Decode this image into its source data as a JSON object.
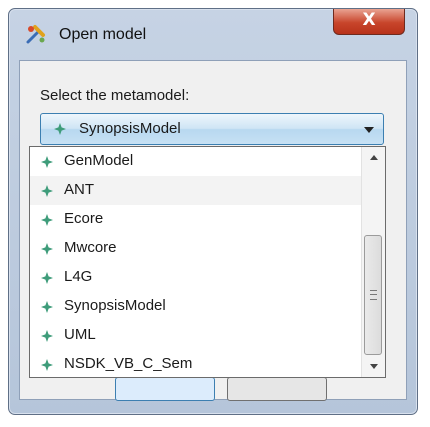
{
  "window": {
    "title": "Open model",
    "close_label": "X"
  },
  "dialog": {
    "label": "Select the metamodel:",
    "selected": "SynopsisModel",
    "options": [
      "GenModel",
      "ANT",
      "Ecore",
      "Mwcore",
      "L4G",
      "SynopsisModel",
      "UML",
      "NSDK_VB_C_Sem"
    ],
    "hovered_option": "ANT"
  },
  "icons": {
    "app": "tools-icon",
    "item": "diamond-sparkle-icon"
  },
  "colors": {
    "item_icon": "#3e9c7a",
    "combo_border": "#3c7fb1",
    "close_button": "#c8452b"
  }
}
